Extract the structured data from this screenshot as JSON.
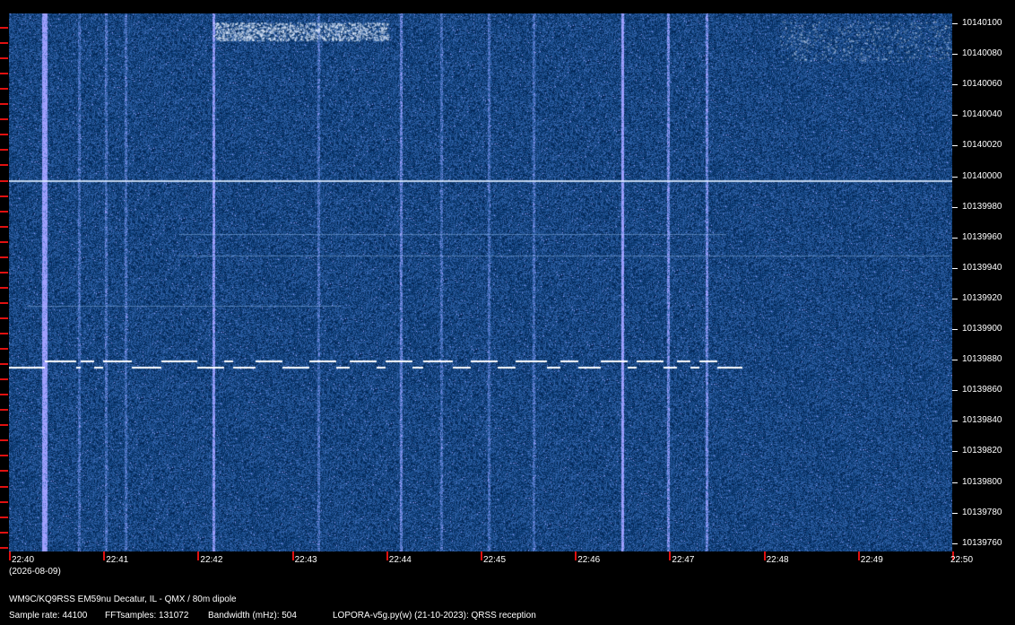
{
  "spectrogram": {
    "colors": {
      "background": "#000000",
      "plot": "#0a1a4a",
      "signal": "#ffffff",
      "tick": "#e01010"
    },
    "freq_labels": [
      "10140100",
      "10140080",
      "10140060",
      "10140040",
      "10140020",
      "10140000",
      "10139980",
      "10139960",
      "10139940",
      "10139920",
      "10139900",
      "10139880",
      "10139860",
      "10139840",
      "10139820",
      "10139800",
      "10139780",
      "10139760"
    ],
    "time_labels": [
      "22:40",
      "22:41",
      "22:42",
      "22:43",
      "22:44",
      "22:45",
      "22:46",
      "22:47",
      "22:48",
      "22:49",
      "22:50"
    ],
    "date": "(2026-08-09)"
  },
  "footer": {
    "station": "WM9C/KQ9RSS EM59nu Decatur, IL - QMX / 80m dipole",
    "sample_rate": "Sample rate: 44100",
    "fft_samples": "FFTsamples: 131072",
    "bandwidth": "Bandwidth (mHz): 504",
    "software": "LOPORA-v5g.py(w) (21-10-2023): QRSS reception"
  }
}
